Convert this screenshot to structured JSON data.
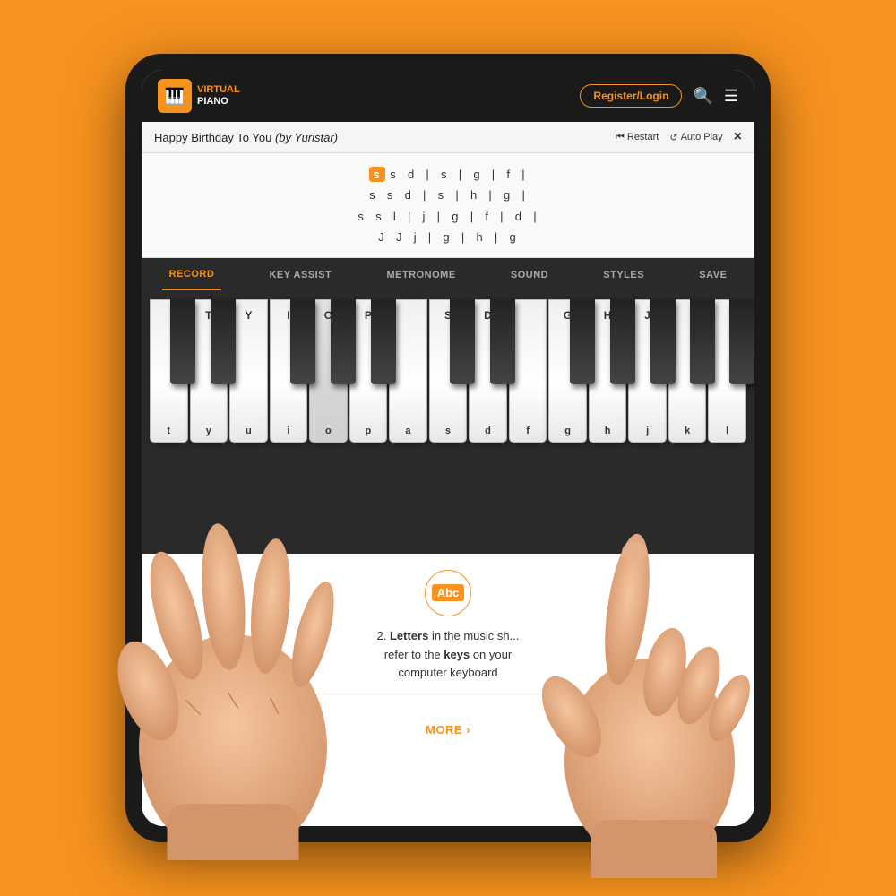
{
  "page": {
    "background_color": "#F7921E"
  },
  "header": {
    "logo_text_line1": "IRTUAL",
    "logo_text_line2": "PIANO",
    "register_label": "Register/Login",
    "search_icon": "search",
    "menu_icon": "menu"
  },
  "song_bar": {
    "title": "Happy Birthday To You",
    "author": "by Yuristar",
    "restart_label": "Restart",
    "autoplay_label": "Auto Play",
    "close_label": "×"
  },
  "sheet": {
    "lines": [
      "s  s  d  |  s  |  g  |  f  |",
      "s  s  d  |  s  |  h  |  g  |",
      "s  s  l  |  j  |  g  |  f  |  d  |",
      "J  J  j  |  g  |  h  |  g"
    ],
    "highlight_char": "s"
  },
  "toolbar": {
    "items": [
      {
        "id": "record",
        "label": "RECORD",
        "active": true
      },
      {
        "id": "key-assist",
        "label": "KEY ASSIST",
        "active": false
      },
      {
        "id": "metronome",
        "label": "METRONOME",
        "active": false
      },
      {
        "id": "sound",
        "label": "SOUND",
        "active": false
      },
      {
        "id": "styles",
        "label": "STYLES",
        "active": false
      },
      {
        "id": "save",
        "label": "SAVE",
        "active": false
      }
    ]
  },
  "piano": {
    "white_keys": [
      {
        "label": "t",
        "upper": ""
      },
      {
        "label": "y",
        "upper": ""
      },
      {
        "label": "u",
        "upper": "T"
      },
      {
        "label": "i",
        "upper": "Y"
      },
      {
        "label": "o",
        "upper": ""
      },
      {
        "label": "p",
        "upper": "I"
      },
      {
        "label": "a",
        "upper": "O"
      },
      {
        "label": "s",
        "upper": "P"
      },
      {
        "label": "d",
        "upper": ""
      },
      {
        "label": "f",
        "upper": "S"
      },
      {
        "label": "g",
        "upper": "D"
      },
      {
        "label": "h",
        "upper": ""
      },
      {
        "label": "j",
        "upper": "G"
      },
      {
        "label": "k",
        "upper": "H"
      },
      {
        "label": "l",
        "upper": "J"
      }
    ]
  },
  "bottom_info": {
    "abc_label": "Abc",
    "point_number": "2.",
    "info_line1": "Letters in the music sh...",
    "info_line2": "refer to the keys on your",
    "info_line3": "computer keyboard",
    "more_label": "MORE ›"
  }
}
